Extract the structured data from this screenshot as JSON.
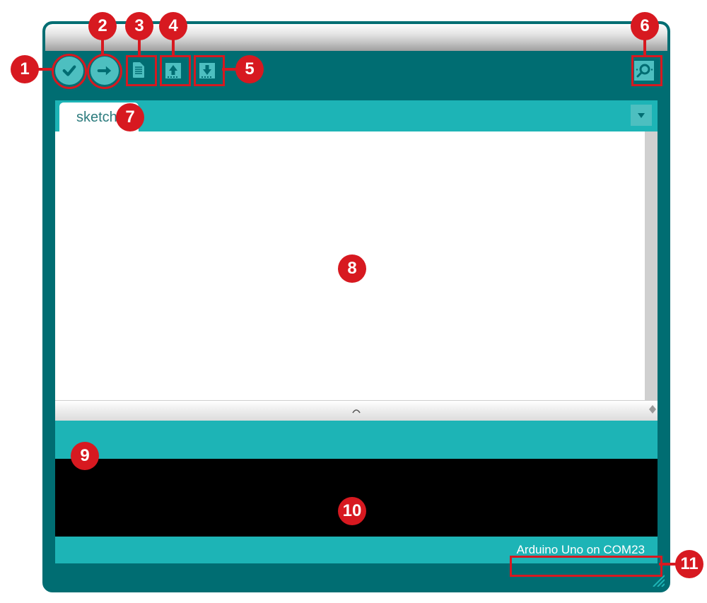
{
  "toolbar": {
    "verify_icon": "checkmark-icon",
    "upload_icon": "arrow-right-icon",
    "new_icon": "file-icon",
    "open_icon": "arrow-up-icon",
    "save_icon": "arrow-down-icon",
    "serial_monitor_icon": "magnifier-icon"
  },
  "tabs": {
    "active_label": "sketch",
    "menu_icon": "triangle-down-icon"
  },
  "editor": {
    "content": ""
  },
  "status_bar": {
    "message": ""
  },
  "console": {
    "output": ""
  },
  "bottom_bar": {
    "board_port": "Arduino Uno on COM23"
  },
  "callouts": {
    "1": "1",
    "2": "2",
    "3": "3",
    "4": "4",
    "5": "5",
    "6": "6",
    "7": "7",
    "8": "8",
    "9": "9",
    "10": "10",
    "11": "11"
  }
}
